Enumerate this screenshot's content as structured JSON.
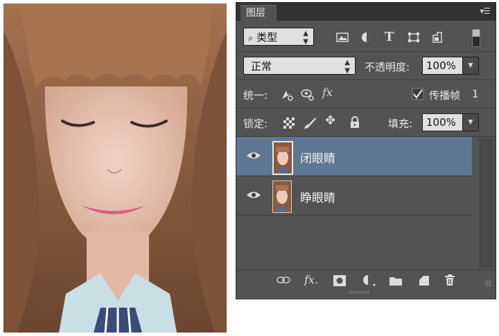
{
  "panel": {
    "tab_label": "图层",
    "menu_icon": "panel-menu-icon",
    "filter": {
      "label": "类型",
      "icon": "search-icon"
    },
    "filter_icons": [
      "image-filter-icon",
      "adjustment-filter-icon",
      "type-filter-icon",
      "shape-filter-icon",
      "smart-object-filter-icon"
    ],
    "blend_mode": "正常",
    "opacity_label": "不透明度:",
    "opacity_value": "100%",
    "unify_label": "统一:",
    "propagate_label": "传播帧",
    "propagate_value": "1",
    "lock_label": "锁定:",
    "fill_label": "填充:",
    "fill_value": "100%",
    "layers": [
      {
        "name": "闭眼睛",
        "visible": true,
        "selected": true
      },
      {
        "name": "睁眼睛",
        "visible": true,
        "selected": false
      }
    ],
    "bottom_icons": [
      "link-layers-icon",
      "fx-icon",
      "layer-mask-icon",
      "adjustment-layer-icon",
      "group-folder-icon",
      "new-layer-icon",
      "trash-icon"
    ],
    "colors": {
      "panel_bg": "#535353",
      "selected_row": "#5e7792",
      "tab_bar": "#323232"
    }
  }
}
